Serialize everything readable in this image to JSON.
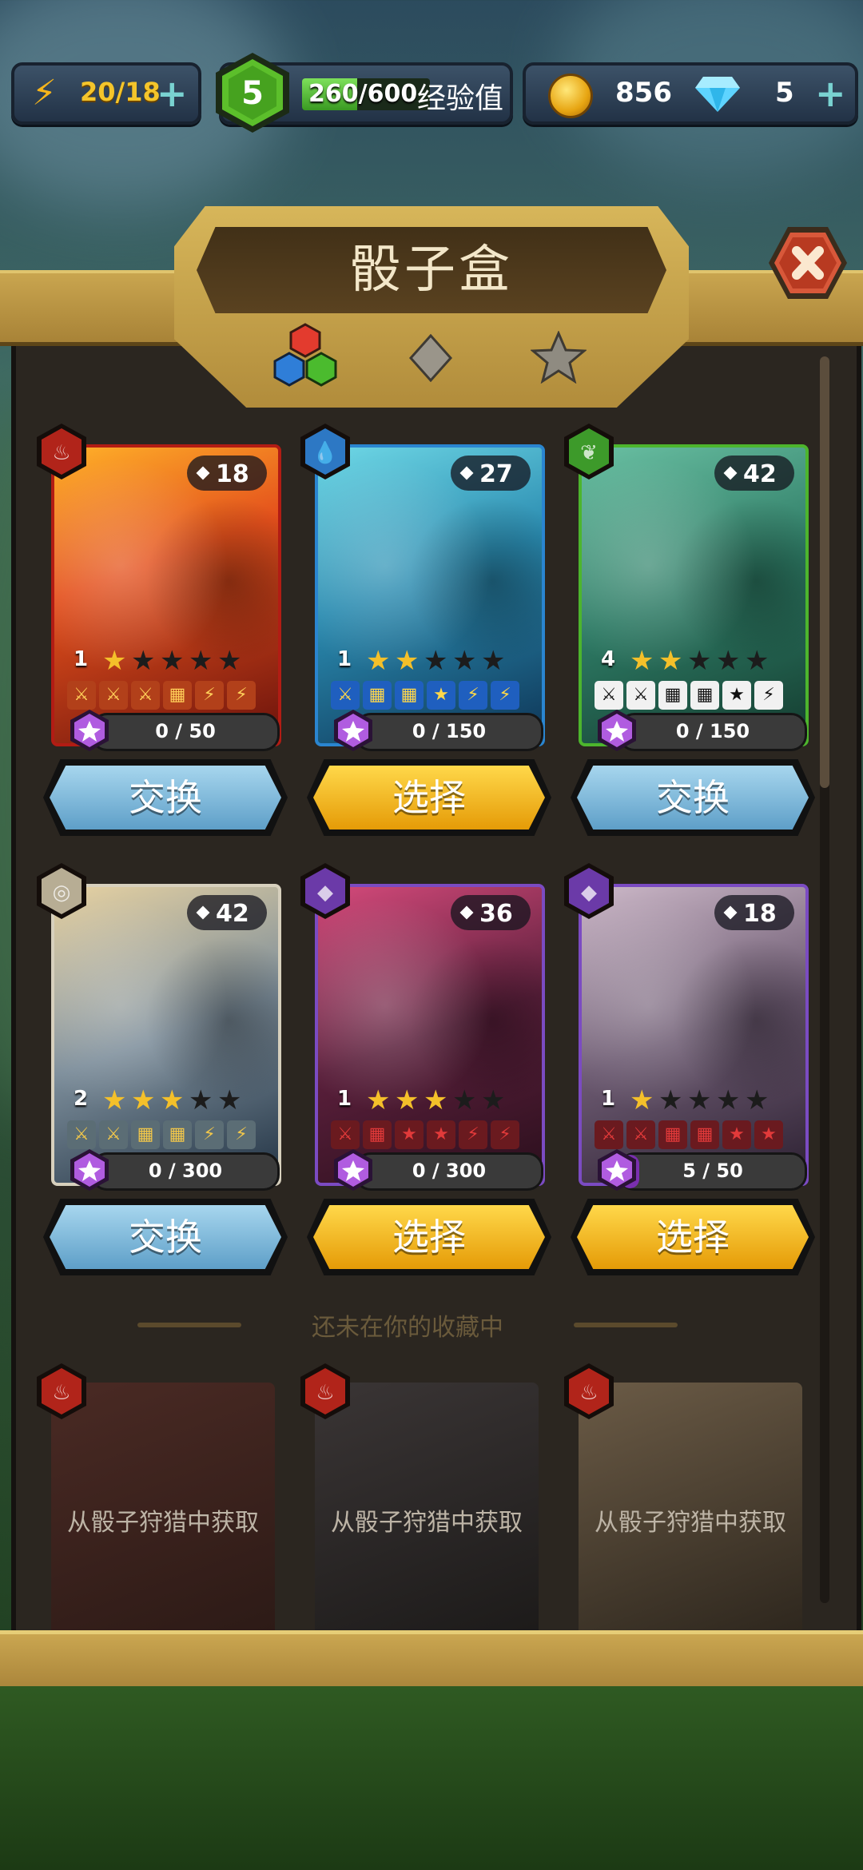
{
  "topbar": {
    "energy": "20/18",
    "level": "5",
    "xp_text": "260/600",
    "xp_fraction": 0.43,
    "xp_label": "经验值",
    "coins": "856",
    "gems": "5"
  },
  "panel": {
    "title": "骰子盒",
    "tabs": [
      "color-filter-icon",
      "gray-gem-icon",
      "star-icon"
    ]
  },
  "cards": [
    {
      "element": "fire",
      "count": "18",
      "level": "1",
      "stars": 1,
      "progress_text": "0 / 50",
      "progress": 0,
      "button": "交换",
      "button_style": "blue"
    },
    {
      "element": "water",
      "count": "27",
      "level": "1",
      "stars": 2,
      "progress_text": "0 / 150",
      "progress": 0,
      "button": "选择",
      "button_style": "gold"
    },
    {
      "element": "nature",
      "count": "42",
      "level": "4",
      "stars": 2,
      "progress_text": "0 / 150",
      "progress": 0,
      "button": "交换",
      "button_style": "blue"
    },
    {
      "element": "air",
      "count": "42",
      "level": "2",
      "stars": 3,
      "progress_text": "0 / 300",
      "progress": 0,
      "button": "交换",
      "button_style": "blue"
    },
    {
      "element": "dark",
      "count": "36",
      "level": "1",
      "stars": 3,
      "progress_text": "0 / 300",
      "progress": 0,
      "button": "选择",
      "button_style": "gold"
    },
    {
      "element": "dark",
      "count": "18",
      "level": "1",
      "stars": 1,
      "progress_text": "5 / 50",
      "progress": 0.1,
      "button": "选择",
      "button_style": "gold"
    }
  ],
  "section_label": "还未在你的收藏中",
  "locked": [
    {
      "element": "fire",
      "text": "从骰子狩猎中获取"
    },
    {
      "element": "fire",
      "text": "从骰子狩猎中获取"
    },
    {
      "element": "fire",
      "text": "从骰子狩猎中获取"
    }
  ],
  "colors": {
    "fire": "#b1241a",
    "water": "#2d78c4",
    "nature": "#3d9a2a",
    "air": "#b7ad94",
    "dark": "#6b3aa8",
    "gold": "#f2b21a",
    "blue_button": "#7ab7dc"
  }
}
